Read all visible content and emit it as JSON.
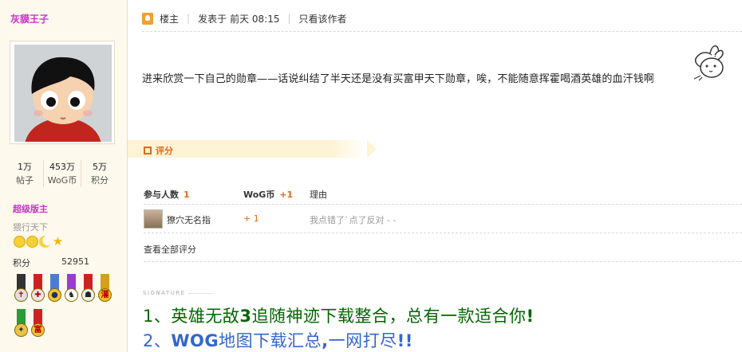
{
  "user": {
    "name": "灰貘王子",
    "stats": [
      {
        "value": "1万",
        "label": "帖子"
      },
      {
        "value": "453万",
        "label": "WoG币"
      },
      {
        "value": "5万",
        "label": "积分"
      }
    ],
    "rank": "超级版主",
    "title": "猥行天下",
    "score_label": "积分",
    "score_value": "52951"
  },
  "post": {
    "author_tag": "楼主",
    "posted_prefix": "发表于",
    "posted_time": "前天 08:15",
    "only_author": "只看该作者",
    "body": "进来欣赏一下自己的勋章——话说纠结了半天还是没有买富甲天下勋章，唉，不能随意挥霍喝酒英雄的血汗钱啊"
  },
  "rating": {
    "section_title": "评分",
    "head_participants": "参与人数",
    "participants_count": "1",
    "head_currency": "WoG币",
    "currency_total": "+1",
    "head_reason": "理由",
    "entries": [
      {
        "name": "獠穴无名指",
        "points": "+ 1",
        "reason": "我点错了`点了反对 - -"
      }
    ],
    "view_all": "查看全部评分"
  },
  "signature": {
    "label": "SIGNATURE",
    "line1_a": "1、英雄无敌",
    "line1_b": "3",
    "line1_c": "追随神迹下载整合，总有一款适合你",
    "line1_d": "!",
    "line2_a": "2、",
    "line2_b": "WOG",
    "line2_c": "地图下载汇总",
    "line2_d": ",",
    "line2_e": "一网打尽",
    "line2_f": "!!"
  },
  "colors": {
    "username": "#cc33cc",
    "accent": "#e06a1a",
    "sig_green": "#006600",
    "sig_blue": "#3366cc",
    "sidebar_bg": "#fdf9ec"
  }
}
